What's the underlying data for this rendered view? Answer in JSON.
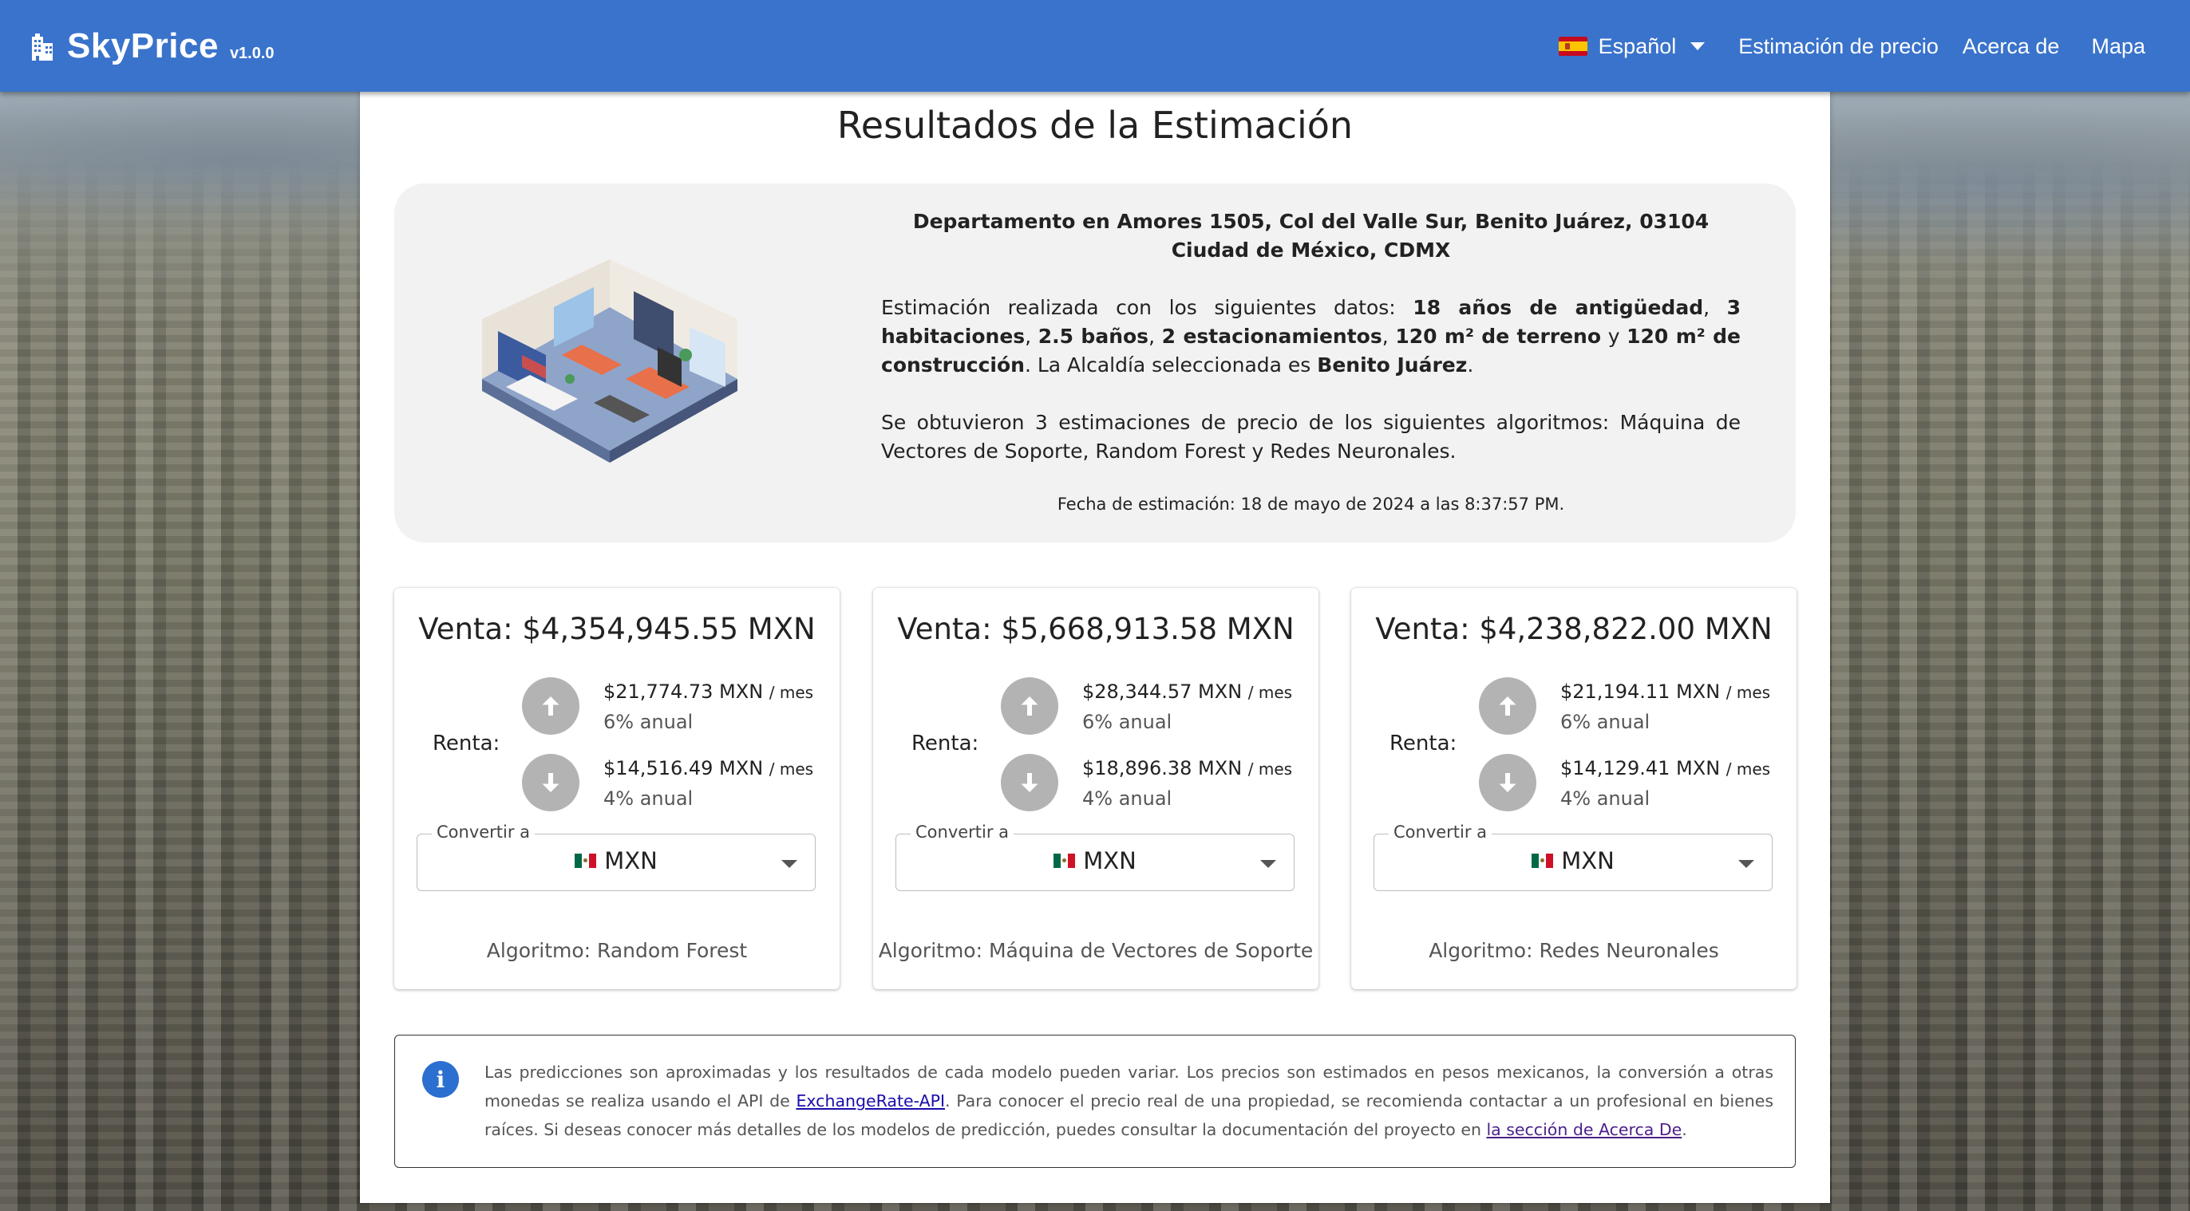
{
  "app": {
    "name": "SkyPrice",
    "version": "v1.0.0"
  },
  "nav": {
    "language": "Español",
    "links": [
      "Estimación de precio",
      "Acerca de",
      "Mapa"
    ]
  },
  "page": {
    "title": "Resultados de la Estimación"
  },
  "summary": {
    "address": "Departamento en Amores 1505, Col del Valle Sur, Benito Juárez, 03104 Ciudad de México, CDMX",
    "details_prefix": "Estimación realizada con los siguientes datos: ",
    "antiguedad": "18 años de antigüedad",
    "habitaciones": "3 habitaciones",
    "banos": "2.5 baños",
    "estacionamientos": "2 estacionamientos",
    "terreno": "120 m² de terreno",
    "construccion": "120 m² de construcción",
    "alcaldia_prefix": ". La Alcaldía seleccionada es ",
    "alcaldia": "Benito Juárez",
    "algorithms_text": "Se obtuvieron 3 estimaciones de precio de los siguientes algoritmos: Máquina de Vectores de Soporte, Random Forest y Redes Neuronales.",
    "date": "Fecha de estimación: 18 de mayo de 2024 a las 8:37:57 PM."
  },
  "cards": [
    {
      "venta": "Venta: $4,354,945.55 MXN",
      "renta_label": "Renta:",
      "rent_high": "$21,774.73 MXN",
      "rent_high_rate": "6% anual",
      "rent_low": "$14,516.49 MXN",
      "rent_low_rate": "4% anual",
      "per_month": "/ mes",
      "convert_label": "Convertir a",
      "currency": "MXN",
      "algorithm": "Algoritmo: Random Forest"
    },
    {
      "venta": "Venta: $5,668,913.58 MXN",
      "renta_label": "Renta:",
      "rent_high": "$28,344.57 MXN",
      "rent_high_rate": "6% anual",
      "rent_low": "$18,896.38 MXN",
      "rent_low_rate": "4% anual",
      "per_month": "/ mes",
      "convert_label": "Convertir a",
      "currency": "MXN",
      "algorithm": "Algoritmo: Máquina de Vectores de Soporte"
    },
    {
      "venta": "Venta: $4,238,822.00 MXN",
      "renta_label": "Renta:",
      "rent_high": "$21,194.11 MXN",
      "rent_high_rate": "6% anual",
      "rent_low": "$14,129.41 MXN",
      "rent_low_rate": "4% anual",
      "per_month": "/ mes",
      "convert_label": "Convertir a",
      "currency": "MXN",
      "algorithm": "Algoritmo: Redes Neuronales"
    }
  ],
  "info": {
    "text1": "Las predicciones son aproximadas y los resultados de cada modelo pueden variar. Los precios son estimados en pesos mexicanos, la conversión a otras monedas se realiza us­ando el API de ",
    "link1": "ExchangeRate-API",
    "text2": ". Para conocer el precio real de una propiedad, se recomienda contactar a un profesional en bienes raíces. Si deseas conocer más detalles de los modelos de predicción, puedes consultar la documentación del proyecto en ",
    "link2": "la sección de Acerca De",
    "text3": "."
  },
  "colors": {
    "navbar": "#3a73cb",
    "info_icon": "#2b6fd0",
    "arrow_button": "#b3b3b3"
  },
  "icons": {
    "logo": "building-icon",
    "up": "arrow-up-icon",
    "down": "arrow-down-icon",
    "info": "info-icon"
  }
}
